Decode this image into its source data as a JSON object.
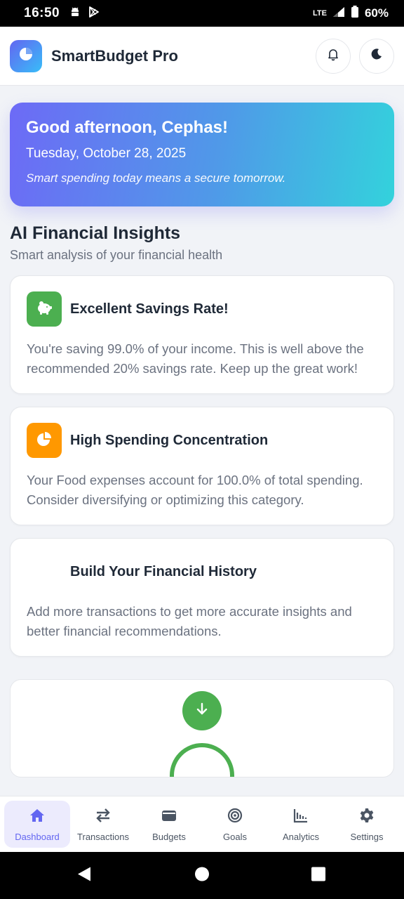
{
  "status_bar": {
    "time": "16:50",
    "network": "LTE",
    "battery": "60%"
  },
  "app": {
    "title": "SmartBudget Pro",
    "notification_icon": "bell-icon",
    "theme_icon": "moon-icon"
  },
  "hero": {
    "greeting": "Good afternoon, Cephas!",
    "date": "Tuesday, October 28, 2025",
    "quote": "Smart spending today means a secure tomorrow."
  },
  "insights": {
    "title": "AI Financial Insights",
    "subtitle": "Smart analysis of your financial health",
    "cards": [
      {
        "icon": "piggy-bank-icon",
        "color": "#4caf50",
        "title": "Excellent Savings Rate!",
        "body": "You're saving 99.0% of your income. This is well above the recommended 20% savings rate. Keep up the great work!"
      },
      {
        "icon": "pie-chart-icon",
        "color": "#ff9800",
        "title": "High Spending Concentration",
        "body": "Your Food expenses account for 100.0% of total spending. Consider diversifying or optimizing this category."
      },
      {
        "icon": "",
        "title": "Build Your Financial History",
        "body": "Add more transactions to get more accurate insights and better financial recommendations."
      }
    ]
  },
  "nav": {
    "items": [
      {
        "label": "Dashboard",
        "icon": "home-icon",
        "active": true
      },
      {
        "label": "Transactions",
        "icon": "transfer-icon",
        "active": false
      },
      {
        "label": "Budgets",
        "icon": "wallet-icon",
        "active": false
      },
      {
        "label": "Goals",
        "icon": "target-icon",
        "active": false
      },
      {
        "label": "Analytics",
        "icon": "chart-icon",
        "active": false
      },
      {
        "label": "Settings",
        "icon": "gear-icon",
        "active": false
      }
    ]
  },
  "colors": {
    "accent": "#6366f1",
    "success": "#4caf50",
    "warning": "#ff9800"
  }
}
